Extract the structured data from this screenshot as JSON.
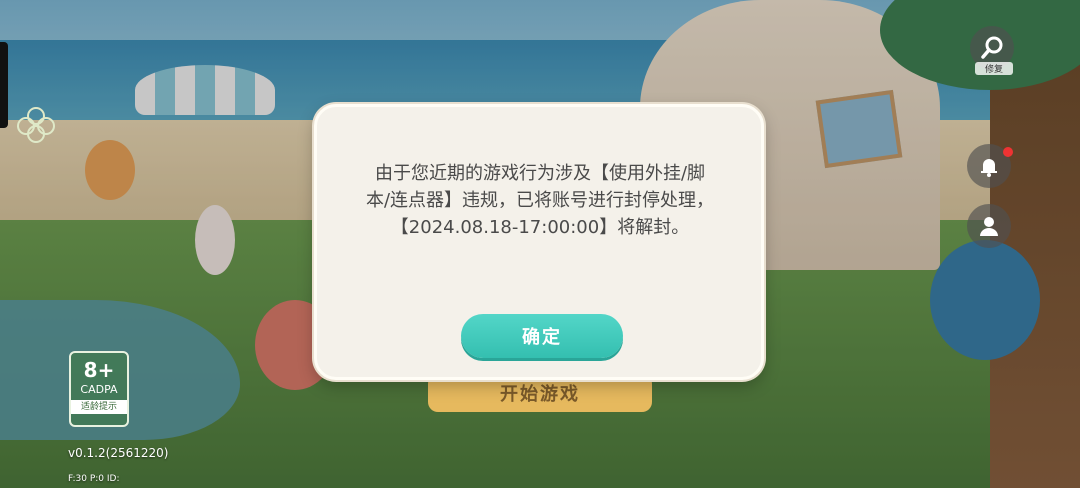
{
  "dialog": {
    "message": "由于您近期的游戏行为涉及【使用外挂/脚本/连点器】违规，已将账号进行封停处理，【2024.08.18-17:00:00】将解封。",
    "confirm_label": "确定"
  },
  "background": {
    "start_button_label": "开始游戏"
  },
  "age_rating": {
    "age": "8+",
    "org": "CADPA",
    "note": "适龄提示"
  },
  "version_text": "v0.1.2(2561220)",
  "stats": {
    "fps": "F:30",
    "ping": "P:0",
    "id": "ID:"
  },
  "right_toolbar": {
    "repair_label": "修复",
    "icons": [
      "wrench-icon",
      "bell-icon",
      "user-icon"
    ]
  },
  "colors": {
    "confirm_button": "#3ccabb",
    "dialog_bg": "#f4f1ea",
    "notification_dot": "#e33333"
  }
}
